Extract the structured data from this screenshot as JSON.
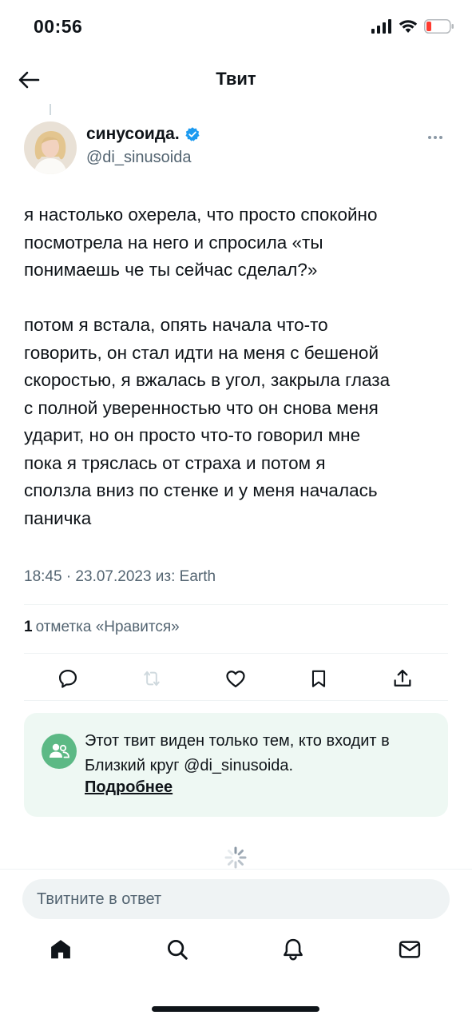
{
  "status_bar": {
    "time": "00:56",
    "icons": [
      "signal-icon",
      "wifi-icon",
      "battery-low-icon"
    ],
    "battery_color": "#ff3b30"
  },
  "header": {
    "title": "Твит",
    "back_icon": "back-arrow-icon"
  },
  "tweet": {
    "author": {
      "name": "синусоида.",
      "handle": "@di_sinusoida",
      "verified": true,
      "verified_color": "#1d9bf0"
    },
    "paragraph_1": "я настолько охерела, что просто спокойно\nпосмотрела на него и спросила «ты\nпонимаешь че ты сейчас сделал?»",
    "paragraph_2": "потом я встала, опять начала что-то\nговорить, он стал идти на меня с бешеной\nскоростью, я вжалась в угол, закрыла глаза\nс полной уверенностью что он снова меня\nударит, но он просто что-то говорил мне\nпока я тряслась от страха и потом я\nсползла вниз по стенке и у меня началась\nпаничка",
    "meta": "18:45 · 23.07.2023 из: Earth",
    "likes_count": "1",
    "likes_label": "отметка «Нравится»",
    "actions": [
      "reply-icon",
      "retweet-icon",
      "like-icon",
      "bookmark-icon",
      "share-icon"
    ]
  },
  "circle_notice": {
    "text": "Этот твит виден только тем, кто входит в Близкий круг @di_sinusoida.",
    "link": "Подробнее",
    "accent": "#5cb985",
    "background": "#eef8f3"
  },
  "reply": {
    "placeholder": "Твитните в ответ"
  },
  "tab_bar": {
    "items": [
      "home-icon",
      "search-icon",
      "notifications-icon",
      "messages-icon"
    ]
  }
}
